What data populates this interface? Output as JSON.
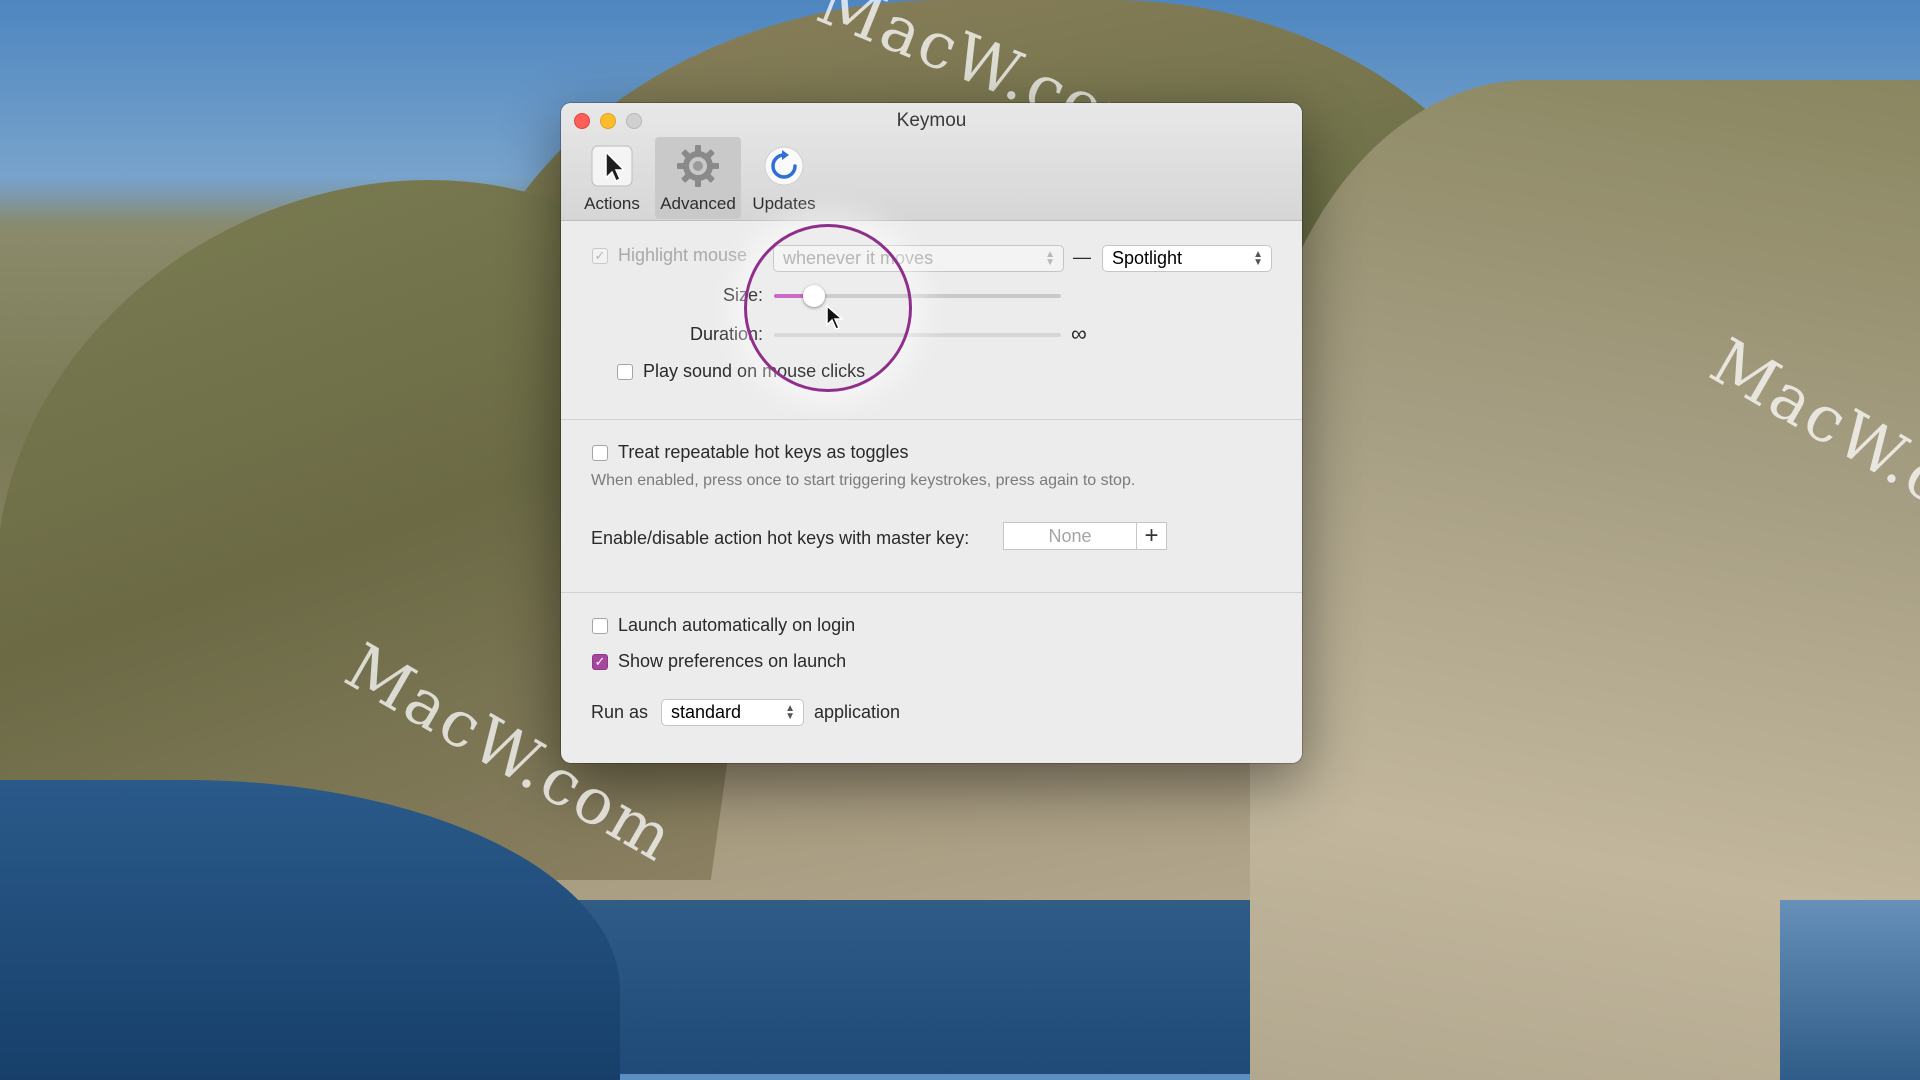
{
  "window": {
    "title": "Keymou"
  },
  "toolbar": {
    "items": [
      {
        "label": "Actions",
        "icon": "arrow-cursor-icon"
      },
      {
        "label": "Advanced",
        "icon": "gear-icon"
      },
      {
        "label": "Updates",
        "icon": "refresh-icon"
      }
    ],
    "selected": "Advanced"
  },
  "highlight": {
    "checkbox_label": "Highlight mouse",
    "checked": true,
    "mode_value": "whenever it moves",
    "dash": "—",
    "style_value": "Spotlight",
    "size_label": "Size:",
    "size_value": 0.14,
    "duration_label": "Duration:",
    "duration_symbol": "∞",
    "sound_label": "Play sound on mouse clicks",
    "sound_checked": false
  },
  "hotkeys": {
    "toggle_label": "Treat repeatable hot keys as toggles",
    "toggle_checked": false,
    "toggle_desc": "When enabled, press once to start triggering keystrokes, press again to stop.",
    "master_label": "Enable/disable action hot keys with master key:",
    "master_value": "None",
    "add_symbol": "+"
  },
  "general": {
    "launch_label": "Launch automatically on login",
    "launch_checked": false,
    "prefs_label": "Show preferences on launch",
    "prefs_checked": true,
    "run_as_prefix": "Run as",
    "run_as_value": "standard",
    "run_as_suffix": "application"
  },
  "watermark": "MacW.com",
  "colors": {
    "accent": "#a5479f",
    "slider_fill": "#c65fc0",
    "magnifier_ring": "#8f2f8c"
  }
}
